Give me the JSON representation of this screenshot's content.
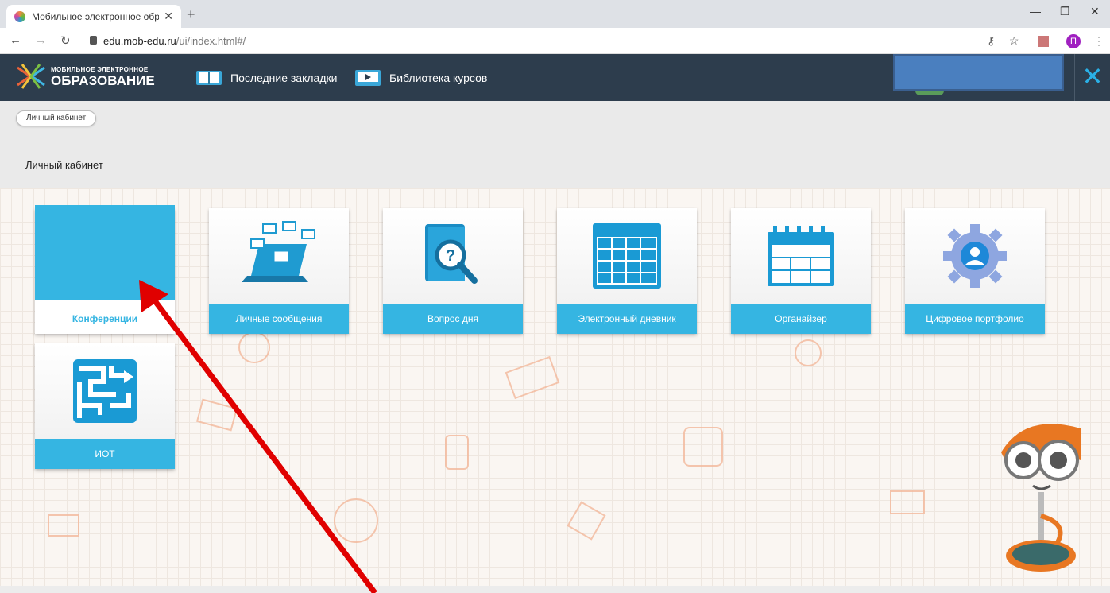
{
  "browser": {
    "tab_title": "Мобильное электронное обра",
    "new_tab": "+",
    "url_host": "edu.mob-edu.ru",
    "url_path": "/ui/index.html#/",
    "profile_initial": "П"
  },
  "header": {
    "logo_top": "МОБИЛЬНОЕ ЭЛЕКТРОННОЕ",
    "logo_main": "ОБРАЗОВАНИЕ",
    "nav": [
      {
        "label": "Последние закладки",
        "icon": "book-icon"
      },
      {
        "label": "Библиотека курсов",
        "icon": "video-library-icon"
      }
    ],
    "close": "✕"
  },
  "breadcrumb": {
    "item": "Личный кабинет"
  },
  "page": {
    "title": "Личный кабинет"
  },
  "tiles": [
    {
      "label": "Конференции",
      "icon": "conference-icon"
    },
    {
      "label": "Личные сообщения",
      "icon": "messages-laptop-icon"
    },
    {
      "label": "Вопрос дня",
      "icon": "question-book-icon"
    },
    {
      "label": "Электронный дневник",
      "icon": "diary-grid-icon"
    },
    {
      "label": "Органайзер",
      "icon": "calendar-icon"
    },
    {
      "label": "Цифровое портфолио",
      "icon": "portfolio-gear-icon"
    },
    {
      "label": "ИОТ",
      "icon": "maze-icon"
    }
  ],
  "colors": {
    "accent": "#35b5e2",
    "header_bg": "#2d3d4d",
    "arrow": "#e00000"
  }
}
